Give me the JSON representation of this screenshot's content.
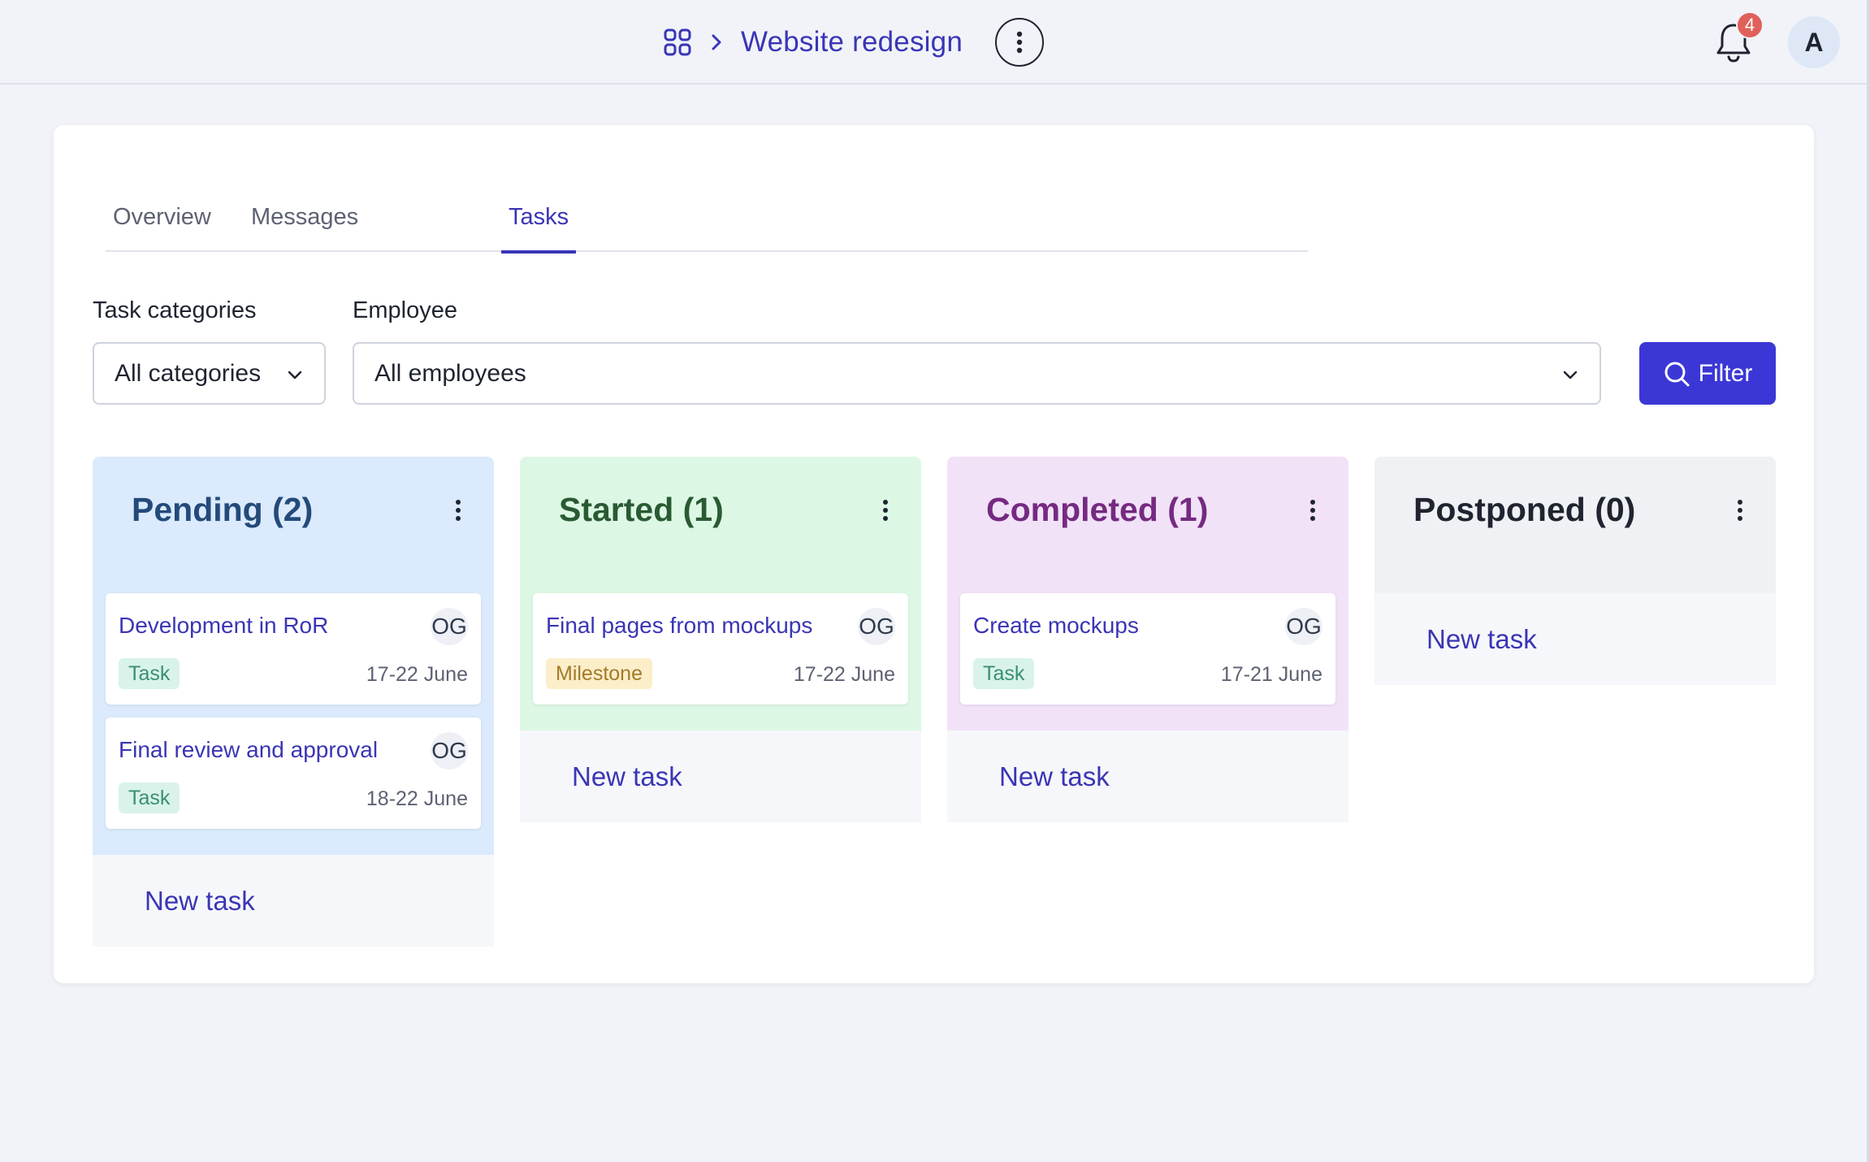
{
  "header": {
    "breadcrumb_title": "Website redesign",
    "notification_count": "4",
    "avatar_initial": "A"
  },
  "tabs": [
    {
      "label": "Overview",
      "active": false
    },
    {
      "label": "Messages",
      "active": false
    },
    {
      "label": "Tasks",
      "active": true
    }
  ],
  "filters": {
    "category_label": "Task categories",
    "category_value": "All categories",
    "employee_label": "Employee",
    "employee_value": "All employees",
    "filter_button": "Filter"
  },
  "columns": [
    {
      "title": "Pending (2)",
      "bg": "#dbeafc",
      "title_color": "#234a7a",
      "new_task": "New task",
      "cards": [
        {
          "title": "Development in RoR",
          "initials": "OG",
          "tag": "Task",
          "date": "17-22 June"
        },
        {
          "title": "Final review and approval",
          "initials": "OG",
          "tag": "Task",
          "date": "18-22 June"
        }
      ]
    },
    {
      "title": "Started (1)",
      "bg": "#dcf8e4",
      "title_color": "#2a5a33",
      "new_task": "New task",
      "cards": [
        {
          "title": "Final pages from mockups",
          "initials": "OG",
          "tag": "Milestone",
          "date": "17-22 June"
        }
      ]
    },
    {
      "title": "Completed (1)",
      "bg": "#f1e2f8",
      "title_color": "#752a80",
      "new_task": "New task",
      "cards": [
        {
          "title": "Create mockups",
          "initials": "OG",
          "tag": "Task",
          "date": "17-21 June"
        }
      ]
    },
    {
      "title": "Postponed (0)",
      "bg": "#eff1f5",
      "title_color": "#1f2430",
      "new_task": "New task",
      "cards": []
    }
  ],
  "colors": {
    "accent": "#3a35b5",
    "filter_button": "#3b37d6",
    "badge": "#e0605a"
  }
}
